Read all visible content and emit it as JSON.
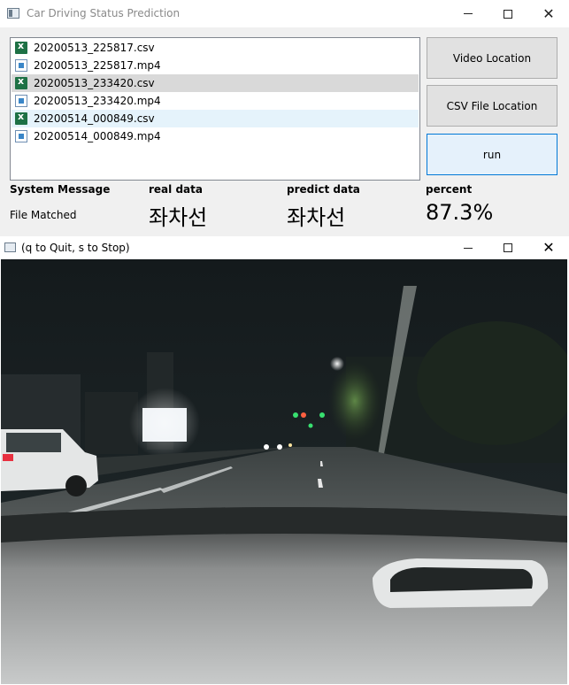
{
  "main_window": {
    "title": "Car Driving Status Prediction",
    "files": [
      {
        "name": "20200513_225817.csv",
        "icon": "excel-file-icon"
      },
      {
        "name": "20200513_225817.mp4",
        "icon": "video-file-icon"
      },
      {
        "name": "20200513_233420.csv",
        "icon": "excel-file-icon"
      },
      {
        "name": "20200513_233420.mp4",
        "icon": "video-file-icon"
      },
      {
        "name": "20200514_000849.csv",
        "icon": "excel-file-icon"
      },
      {
        "name": "20200514_000849.mp4",
        "icon": "video-file-icon"
      }
    ],
    "buttons": {
      "video_location": "Video Location",
      "csv_location": "CSV File Location",
      "run": "run"
    },
    "headers": {
      "system_message": "System Message",
      "real_data": "real data",
      "predict_data": "predict data",
      "percent": "percent"
    },
    "values": {
      "system_message": "File Matched",
      "real_data": "좌차선",
      "predict_data": "좌차선",
      "percent": "87.3%"
    }
  },
  "video_window": {
    "title": "(q to Quit, s to Stop)"
  },
  "colors": {
    "selected_row": "#d9d9d9",
    "hover_row": "#e5f3fb",
    "run_button_border": "#0078d7"
  }
}
